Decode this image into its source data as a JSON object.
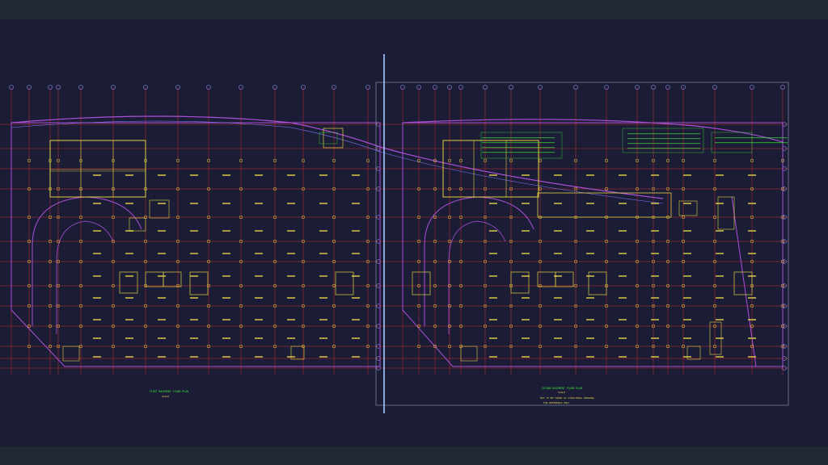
{
  "app": {
    "title": ""
  },
  "drawing": {
    "left_sheet_title": "FIRST BASEMENT FLOOR PLAN",
    "left_sheet_scale": "SCALE",
    "right_sheet_title": "SECOND BASEMENT FLOOR PLAN",
    "right_sheet_scale": "SCALE",
    "right_note_1": "NOT TO BE TAKEN AS STRUCTURAL DRAWING",
    "right_note_2": "FOR REFERENCE ONLY",
    "colors": {
      "background": "#1b1d36",
      "frame": "#222834",
      "grid_lines": "#d02a2a",
      "walls": "#a94fd6",
      "columns": "#e0d040",
      "text": "#e6d34a",
      "dimension": "#3ee03e",
      "cursor": "#a8c8ff"
    },
    "icons": [
      "crosshair-cursor-icon"
    ]
  }
}
